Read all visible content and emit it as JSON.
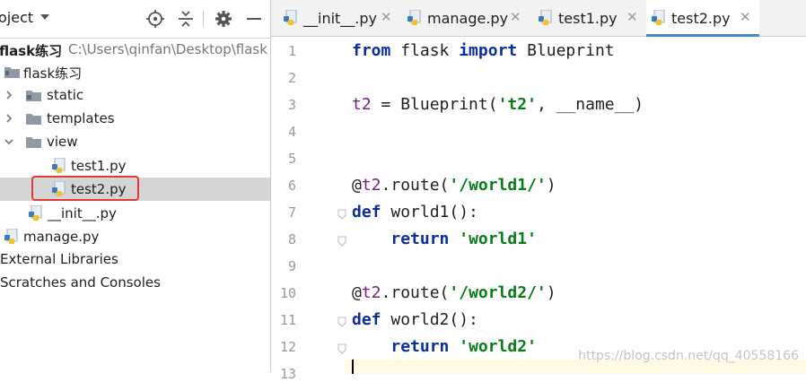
{
  "project_panel": {
    "title": "oject",
    "root": {
      "name": "flask练习",
      "path": "C:\\Users\\qinfan\\Desktop\\flask"
    },
    "items": [
      {
        "label": "flask练习",
        "kind": "folder"
      },
      {
        "label": "static",
        "kind": "folder"
      },
      {
        "label": "templates",
        "kind": "folder"
      },
      {
        "label": "view",
        "kind": "folder"
      },
      {
        "label": "test1.py",
        "kind": "python-file"
      },
      {
        "label": "test2.py",
        "kind": "python-file",
        "selected": true
      },
      {
        "label": "__init__.py",
        "kind": "python-file"
      },
      {
        "label": "manage.py",
        "kind": "python-file"
      },
      {
        "label": "External Libraries",
        "kind": "libraries"
      },
      {
        "label": "Scratches and Consoles",
        "kind": "scratches"
      }
    ]
  },
  "tabs": [
    {
      "label": "__init__.py",
      "active": false
    },
    {
      "label": "manage.py",
      "active": false
    },
    {
      "label": "test1.py",
      "active": false
    },
    {
      "label": "test2.py",
      "active": true
    }
  ],
  "editor": {
    "line_numbers": [
      "1",
      "2",
      "3",
      "4",
      "5",
      "6",
      "7",
      "8",
      "9",
      "10",
      "11",
      "12",
      "13"
    ],
    "lines": [
      {
        "line": "1",
        "segments": [
          [
            "kw",
            "from"
          ],
          [
            "",
            " flask "
          ],
          [
            "kw",
            "import"
          ],
          [
            "",
            " Blueprint"
          ]
        ]
      },
      {
        "line": "3",
        "segments": [
          [
            "var",
            "t2"
          ],
          [
            "",
            " = Blueprint("
          ],
          [
            "str",
            "'t2'"
          ],
          [
            "",
            ", __name__)"
          ]
        ]
      },
      {
        "line": "6",
        "segments": [
          [
            "deco",
            "@"
          ],
          [
            "var",
            "t2"
          ],
          [
            "",
            ".route("
          ],
          [
            "str",
            "'/world1/'"
          ],
          [
            "",
            ")"
          ]
        ]
      },
      {
        "line": "7",
        "segments": [
          [
            "kw",
            "def"
          ],
          [
            "",
            " world1():"
          ]
        ]
      },
      {
        "line": "8",
        "segments": [
          [
            "",
            "    "
          ],
          [
            "kw",
            "return"
          ],
          [
            "",
            " "
          ],
          [
            "str",
            "'world1'"
          ]
        ]
      },
      {
        "line": "10",
        "segments": [
          [
            "deco",
            "@"
          ],
          [
            "var",
            "t2"
          ],
          [
            "",
            ".route("
          ],
          [
            "str",
            "'/world2/'"
          ],
          [
            "",
            ")"
          ]
        ]
      },
      {
        "line": "11",
        "segments": [
          [
            "kw",
            "def"
          ],
          [
            "",
            " world2():"
          ]
        ]
      },
      {
        "line": "12",
        "segments": [
          [
            "",
            "    "
          ],
          [
            "kw",
            "return"
          ],
          [
            "",
            " "
          ],
          [
            "str",
            "'world2'"
          ]
        ]
      }
    ]
  },
  "watermark": "https://blog.csdn.net/qq_40558166",
  "colors": {
    "accent": "#4a88c7",
    "selection": "#d5d5d5",
    "highlight_box": "#e53935",
    "keyword": "#0a2f9c",
    "string": "#067d17"
  },
  "icons": [
    "project-dropdown-icon",
    "locate-icon",
    "collapse-icon",
    "settings-icon",
    "hide-icon",
    "folder-icon",
    "python-file-icon",
    "chevron-right-icon",
    "chevron-down-icon",
    "close-icon",
    "fold-marker-icon"
  ]
}
